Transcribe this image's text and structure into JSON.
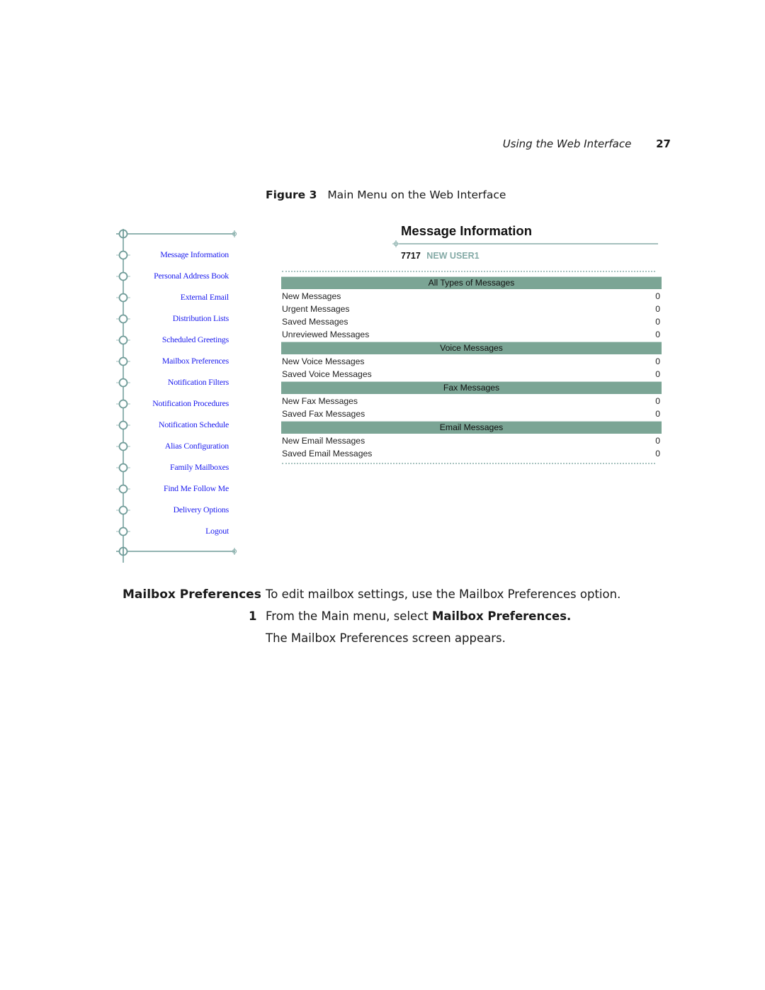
{
  "header": {
    "section_title": "Using the Web Interface",
    "page_number": "27"
  },
  "figure": {
    "label": "Figure 3",
    "caption": "Main Menu on the Web Interface"
  },
  "menu": {
    "items": [
      {
        "label": "Message Information"
      },
      {
        "label": "Personal Address Book"
      },
      {
        "label": "External Email"
      },
      {
        "label": "Distribution Lists"
      },
      {
        "label": "Scheduled Greetings"
      },
      {
        "label": "Mailbox Preferences"
      },
      {
        "label": "Notification Filters"
      },
      {
        "label": "Notification Procedures"
      },
      {
        "label": "Notification Schedule"
      },
      {
        "label": "Alias Configuration"
      },
      {
        "label": "Family Mailboxes"
      },
      {
        "label": "Find Me Follow Me"
      },
      {
        "label": "Delivery Options"
      },
      {
        "label": "Logout"
      }
    ]
  },
  "panel": {
    "title": "Message Information",
    "extension": "7717",
    "user_name": "NEW USER1",
    "sections": [
      {
        "heading": "All Types of Messages",
        "rows": [
          {
            "label": "New Messages",
            "value": "0"
          },
          {
            "label": "Urgent Messages",
            "value": "0"
          },
          {
            "label": "Saved Messages",
            "value": "0"
          },
          {
            "label": "Unreviewed Messages",
            "value": "0"
          }
        ]
      },
      {
        "heading": "Voice Messages",
        "rows": [
          {
            "label": "New Voice Messages",
            "value": "0"
          },
          {
            "label": "Saved Voice Messages",
            "value": "0"
          }
        ]
      },
      {
        "heading": "Fax Messages",
        "rows": [
          {
            "label": "New Fax Messages",
            "value": "0"
          },
          {
            "label": "Saved Fax Messages",
            "value": "0"
          }
        ]
      },
      {
        "heading": "Email Messages",
        "rows": [
          {
            "label": "New Email Messages",
            "value": "0"
          },
          {
            "label": "Saved Email Messages",
            "value": "0"
          }
        ]
      }
    ]
  },
  "body": {
    "side_heading": "Mailbox Preferences",
    "intro": "To edit mailbox settings, use the Mailbox Preferences option.",
    "step_number": "1",
    "step_text_prefix": "From the Main menu, select ",
    "step_text_bold": "Mailbox Preferences.",
    "result_text": "The Mailbox Preferences screen appears."
  },
  "colors": {
    "link": "#1a1aee",
    "section_header_bg": "#7ba595",
    "rail": "#6f9b98",
    "user_name": "#84aaa6"
  }
}
